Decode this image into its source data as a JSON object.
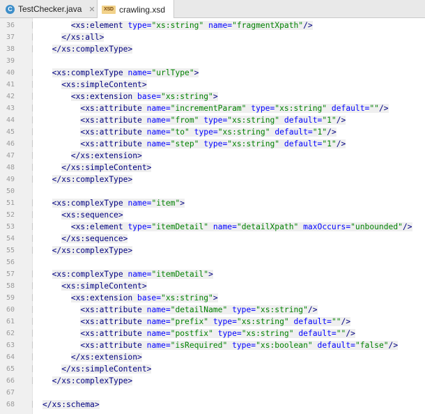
{
  "tabs": [
    {
      "label": "TestChecker.java",
      "icon": "java-class-icon",
      "icon_text": "C",
      "active": false,
      "close": "✕"
    },
    {
      "label": "crawling.xsd",
      "icon": "xsd-file-icon",
      "icon_text": "XSD",
      "active": true
    }
  ],
  "colors": {
    "tag": "#000080",
    "attr_name": "#0000ff",
    "attr_value": "#008000"
  },
  "editor": {
    "lines": [
      {
        "n": "36",
        "indent": 6,
        "tokens": [
          {
            "c": "tag",
            "t": "<xs:element "
          },
          {
            "c": "attr",
            "t": "type="
          },
          {
            "c": "val",
            "t": "\"xs:string\" "
          },
          {
            "c": "attr",
            "t": "name="
          },
          {
            "c": "val",
            "t": "\"fragmentXpath\""
          },
          {
            "c": "tag",
            "t": "/>"
          }
        ]
      },
      {
        "n": "37",
        "indent": 4,
        "tokens": [
          {
            "c": "tag",
            "t": "</xs:all>"
          }
        ]
      },
      {
        "n": "38",
        "indent": 2,
        "tokens": [
          {
            "c": "tag",
            "t": "</xs:complexType>"
          }
        ]
      },
      {
        "n": "39",
        "indent": 0,
        "tokens": []
      },
      {
        "n": "40",
        "indent": 2,
        "tokens": [
          {
            "c": "tag",
            "t": "<xs:complexType "
          },
          {
            "c": "attr",
            "t": "name="
          },
          {
            "c": "val",
            "t": "\"urlType\""
          },
          {
            "c": "tag",
            "t": ">"
          }
        ]
      },
      {
        "n": "41",
        "indent": 4,
        "tokens": [
          {
            "c": "tag",
            "t": "<xs:simpleContent>"
          }
        ]
      },
      {
        "n": "42",
        "indent": 6,
        "tokens": [
          {
            "c": "tag",
            "t": "<xs:extension "
          },
          {
            "c": "attr",
            "t": "base="
          },
          {
            "c": "val",
            "t": "\"xs:string\""
          },
          {
            "c": "tag",
            "t": ">"
          }
        ]
      },
      {
        "n": "43",
        "indent": 8,
        "tokens": [
          {
            "c": "tag",
            "t": "<xs:attribute "
          },
          {
            "c": "attr",
            "t": "name="
          },
          {
            "c": "val",
            "t": "\"incrementParam\" "
          },
          {
            "c": "attr",
            "t": "type="
          },
          {
            "c": "val",
            "t": "\"xs:string\" "
          },
          {
            "c": "attr",
            "t": "default="
          },
          {
            "c": "val",
            "t": "\"\""
          },
          {
            "c": "tag",
            "t": "/>"
          }
        ]
      },
      {
        "n": "44",
        "indent": 8,
        "tokens": [
          {
            "c": "tag",
            "t": "<xs:attribute "
          },
          {
            "c": "attr",
            "t": "name="
          },
          {
            "c": "val",
            "t": "\"from\" "
          },
          {
            "c": "attr",
            "t": "type="
          },
          {
            "c": "val",
            "t": "\"xs:string\" "
          },
          {
            "c": "attr",
            "t": "default="
          },
          {
            "c": "val",
            "t": "\"1\""
          },
          {
            "c": "tag",
            "t": "/>"
          }
        ]
      },
      {
        "n": "45",
        "indent": 8,
        "tokens": [
          {
            "c": "tag",
            "t": "<xs:attribute "
          },
          {
            "c": "attr",
            "t": "name="
          },
          {
            "c": "val",
            "t": "\"to\" "
          },
          {
            "c": "attr",
            "t": "type="
          },
          {
            "c": "val",
            "t": "\"xs:string\" "
          },
          {
            "c": "attr",
            "t": "default="
          },
          {
            "c": "val",
            "t": "\"1\""
          },
          {
            "c": "tag",
            "t": "/>"
          }
        ]
      },
      {
        "n": "46",
        "indent": 8,
        "tokens": [
          {
            "c": "tag",
            "t": "<xs:attribute "
          },
          {
            "c": "attr",
            "t": "name="
          },
          {
            "c": "val",
            "t": "\"step\" "
          },
          {
            "c": "attr",
            "t": "type="
          },
          {
            "c": "val",
            "t": "\"xs:string\" "
          },
          {
            "c": "attr",
            "t": "default="
          },
          {
            "c": "val",
            "t": "\"1\""
          },
          {
            "c": "tag",
            "t": "/>"
          }
        ]
      },
      {
        "n": "47",
        "indent": 6,
        "tokens": [
          {
            "c": "tag",
            "t": "</xs:extension>"
          }
        ]
      },
      {
        "n": "48",
        "indent": 4,
        "tokens": [
          {
            "c": "tag",
            "t": "</xs:simpleContent>"
          }
        ]
      },
      {
        "n": "49",
        "indent": 2,
        "tokens": [
          {
            "c": "tag",
            "t": "</xs:complexType>"
          }
        ]
      },
      {
        "n": "50",
        "indent": 0,
        "tokens": []
      },
      {
        "n": "51",
        "indent": 2,
        "tokens": [
          {
            "c": "tag",
            "t": "<xs:complexType "
          },
          {
            "c": "attr",
            "t": "name="
          },
          {
            "c": "val",
            "t": "\"item\""
          },
          {
            "c": "tag",
            "t": ">"
          }
        ]
      },
      {
        "n": "52",
        "indent": 4,
        "tokens": [
          {
            "c": "tag",
            "t": "<xs:sequence>"
          }
        ]
      },
      {
        "n": "53",
        "indent": 6,
        "tokens": [
          {
            "c": "tag",
            "t": "<xs:element "
          },
          {
            "c": "attr",
            "t": "type="
          },
          {
            "c": "val",
            "t": "\"itemDetail\" "
          },
          {
            "c": "attr",
            "t": "name="
          },
          {
            "c": "val",
            "t": "\"detailXpath\" "
          },
          {
            "c": "attr",
            "t": "maxOccurs="
          },
          {
            "c": "val",
            "t": "\"unbounded\""
          },
          {
            "c": "tag",
            "t": "/>"
          }
        ]
      },
      {
        "n": "54",
        "indent": 4,
        "tokens": [
          {
            "c": "tag",
            "t": "</xs:sequence>"
          }
        ]
      },
      {
        "n": "55",
        "indent": 2,
        "tokens": [
          {
            "c": "tag",
            "t": "</xs:complexType>"
          }
        ]
      },
      {
        "n": "56",
        "indent": 0,
        "tokens": []
      },
      {
        "n": "57",
        "indent": 2,
        "tokens": [
          {
            "c": "tag",
            "t": "<xs:complexType "
          },
          {
            "c": "attr",
            "t": "name="
          },
          {
            "c": "val",
            "t": "\"itemDetail\""
          },
          {
            "c": "tag",
            "t": ">"
          }
        ]
      },
      {
        "n": "58",
        "indent": 4,
        "tokens": [
          {
            "c": "tag",
            "t": "<xs:simpleContent>"
          }
        ]
      },
      {
        "n": "59",
        "indent": 6,
        "tokens": [
          {
            "c": "tag",
            "t": "<xs:extension "
          },
          {
            "c": "attr",
            "t": "base="
          },
          {
            "c": "val",
            "t": "\"xs:string\""
          },
          {
            "c": "tag",
            "t": ">"
          }
        ]
      },
      {
        "n": "60",
        "indent": 8,
        "tokens": [
          {
            "c": "tag",
            "t": "<xs:attribute "
          },
          {
            "c": "attr",
            "t": "name="
          },
          {
            "c": "val",
            "t": "\"detailName\" "
          },
          {
            "c": "attr",
            "t": "type="
          },
          {
            "c": "val",
            "t": "\"xs:string\""
          },
          {
            "c": "tag",
            "t": "/>"
          }
        ]
      },
      {
        "n": "61",
        "indent": 8,
        "tokens": [
          {
            "c": "tag",
            "t": "<xs:attribute "
          },
          {
            "c": "attr",
            "t": "name="
          },
          {
            "c": "val",
            "t": "\"prefix\" "
          },
          {
            "c": "attr",
            "t": "type="
          },
          {
            "c": "val",
            "t": "\"xs:string\" "
          },
          {
            "c": "attr",
            "t": "default="
          },
          {
            "c": "val",
            "t": "\"\""
          },
          {
            "c": "tag",
            "t": "/>"
          }
        ]
      },
      {
        "n": "62",
        "indent": 8,
        "tokens": [
          {
            "c": "tag",
            "t": "<xs:attribute "
          },
          {
            "c": "attr",
            "t": "name="
          },
          {
            "c": "val",
            "t": "\"postfix\" "
          },
          {
            "c": "attr",
            "t": "type="
          },
          {
            "c": "val",
            "t": "\"xs:string\" "
          },
          {
            "c": "attr",
            "t": "default="
          },
          {
            "c": "val",
            "t": "\"\""
          },
          {
            "c": "tag",
            "t": "/>"
          }
        ]
      },
      {
        "n": "63",
        "indent": 8,
        "tokens": [
          {
            "c": "tag",
            "t": "<xs:attribute "
          },
          {
            "c": "attr",
            "t": "name="
          },
          {
            "c": "val",
            "t": "\"isRequired\" "
          },
          {
            "c": "attr",
            "t": "type="
          },
          {
            "c": "val",
            "t": "\"xs:boolean\" "
          },
          {
            "c": "attr",
            "t": "default="
          },
          {
            "c": "val",
            "t": "\"false\""
          },
          {
            "c": "tag",
            "t": "/>"
          }
        ]
      },
      {
        "n": "64",
        "indent": 6,
        "tokens": [
          {
            "c": "tag",
            "t": "</xs:extension>"
          }
        ]
      },
      {
        "n": "65",
        "indent": 4,
        "tokens": [
          {
            "c": "tag",
            "t": "</xs:simpleContent>"
          }
        ]
      },
      {
        "n": "66",
        "indent": 2,
        "tokens": [
          {
            "c": "tag",
            "t": "</xs:complexType>"
          }
        ]
      },
      {
        "n": "67",
        "indent": 0,
        "tokens": []
      },
      {
        "n": "68",
        "indent": 0,
        "tokens": [
          {
            "c": "tag",
            "t": "</xs:schema>"
          }
        ]
      }
    ]
  }
}
